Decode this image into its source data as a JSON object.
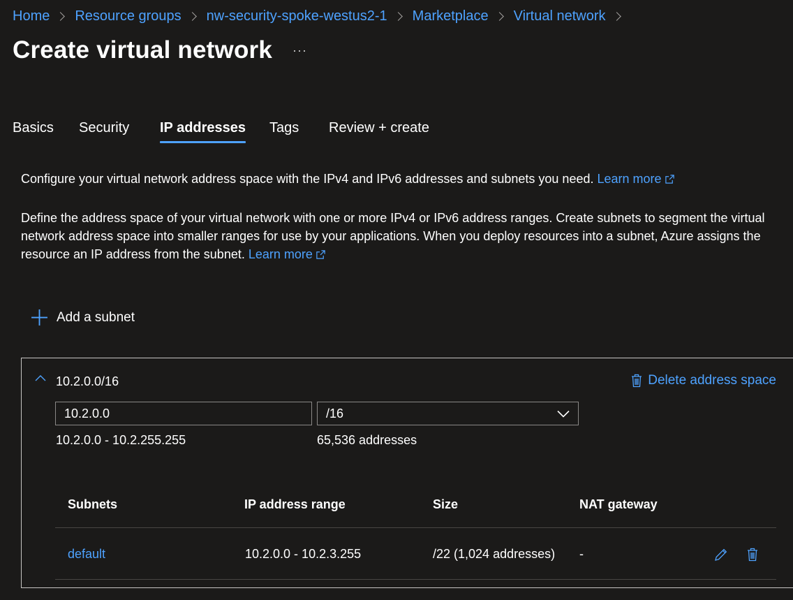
{
  "breadcrumb": {
    "items": [
      "Home",
      "Resource groups",
      "nw-security-spoke-westus2-1",
      "Marketplace",
      "Virtual network"
    ]
  },
  "page": {
    "title": "Create virtual network",
    "more_icon": "ellipsis-icon"
  },
  "tabs": [
    {
      "label": "Basics",
      "active": false
    },
    {
      "label": "Security",
      "active": false
    },
    {
      "label": "IP addresses",
      "active": true
    },
    {
      "label": "Tags",
      "active": false
    },
    {
      "label": "Review + create",
      "active": false
    }
  ],
  "intro": {
    "text": "Configure your virtual network address space with the IPv4 and IPv6 addresses and subnets you need.",
    "link": "Learn more"
  },
  "description": {
    "text": "Define the address space of your virtual network with one or more IPv4 or IPv6 address ranges. Create subnets to segment the virtual network address space into smaller ranges for use by your applications. When you deploy resources into a subnet, Azure assigns the resource an IP address from the subnet.",
    "link": "Learn more"
  },
  "add_subnet_label": "Add a subnet",
  "address_space": {
    "title": "10.2.0.0/16",
    "delete_label": "Delete address space",
    "start_address": "10.2.0.0",
    "prefix": "/16",
    "range": "10.2.0.0 - 10.2.255.255",
    "count": "65,536 addresses"
  },
  "subnets_table": {
    "headers": [
      "Subnets",
      "IP address range",
      "Size",
      "NAT gateway"
    ],
    "rows": [
      {
        "name": "default",
        "range": "10.2.0.0 - 10.2.3.255",
        "size": "/22 (1,024 addresses)",
        "nat": "-"
      }
    ]
  },
  "colors": {
    "background": "#1b1a19",
    "link": "#4ea2ff",
    "border": "#c8c6c4"
  }
}
